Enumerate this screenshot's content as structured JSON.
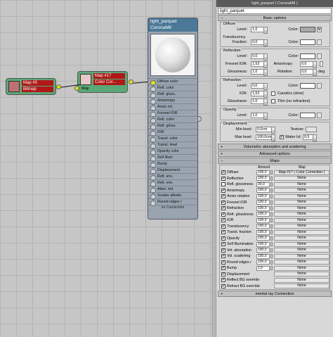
{
  "graph": {
    "bitmap_node": {
      "title": "Map #0",
      "subtitle": "Bitmap"
    },
    "cc_node": {
      "title": "Map #17",
      "subtitle": "Color Cor...",
      "port": "Map"
    },
    "material_node": {
      "title": "light_parquet",
      "subtitle": "CoronaMtl",
      "slots": [
        "Diffuse color",
        "Refl. color",
        "Refl. gloss.",
        "Anisotropy",
        "Aniso rot.",
        "Fresnel IOR",
        "Refr. color",
        "Refr. gloss.",
        "IOR",
        "Transl. color",
        "Transl. level",
        "Opacity color",
        "Self illum",
        "Bump",
        "Displacement",
        "Refl. env.",
        "Refr. env.",
        "Atten. tint",
        "Scatter albedo",
        "Round edges r"
      ],
      "footer": "mr Connection"
    },
    "node_color": "#5aa878",
    "header_color": "#b01818",
    "link_dot_color": "#dede10"
  },
  "panel": {
    "title": "light_parquet  ( CoronaMtl )",
    "name": "light_parquet",
    "basic_options": "Basic options",
    "diffuse": {
      "group": "Diffuse",
      "level_label": "Level:",
      "level": "1,0",
      "color_label": "Color:",
      "color": "#a8a8a8",
      "m": "M"
    },
    "translucency": {
      "group": "Translucency",
      "fraction_label": "Fraction:",
      "fraction": "0,0",
      "color_label": "Color:"
    },
    "reflection": {
      "group": "Reflection",
      "level_label": "Level:",
      "level": "0,0",
      "color_label": "Color:",
      "fresnel_label": "Fresnel IOR:",
      "fresnel": "1,52",
      "aniso_label": "Anisotropy:",
      "aniso": "0,0",
      "gloss_label": "Glossiness:",
      "gloss": "1,0",
      "rotation_label": "Rotation:",
      "rotation": "0,0",
      "rotation_unit": "deg"
    },
    "refraction": {
      "group": "Refraction",
      "level_label": "Level:",
      "level": "0,0",
      "color_label": "Color:",
      "ior_label": "IOR:",
      "ior": "1,52",
      "caustics": "Caustics (slow)",
      "gloss_label": "Glossiness:",
      "gloss": "1,0",
      "thin": "Thin (no refraction)"
    },
    "opacity": {
      "group": "Opacity",
      "level_label": "Level:",
      "level": "1,0",
      "color_label": "Color:"
    },
    "displacement": {
      "group": "Displacement",
      "min_label": "Min level:",
      "min": "0,0cm",
      "texture_label": "Texture:",
      "max_label": "Max level:",
      "max": "100,0cm",
      "water_label": "Water lvl:",
      "water": "0,5"
    },
    "rollouts": {
      "volumetric": "Volumetric absorption and scattering",
      "advanced": "Advanced options",
      "maps": "Maps",
      "mental_ray": "mental ray Connection"
    },
    "maps_table": {
      "amount_header": "Amount",
      "map_header": "Map",
      "rows": [
        {
          "checked": true,
          "name": "Diffuse",
          "amount": "100,0",
          "map": "Map #17  ( Color Correction )"
        },
        {
          "checked": true,
          "name": "Reflection",
          "amount": "100,0",
          "map": "None"
        },
        {
          "checked": false,
          "name": "Refl. glossiness",
          "amount": "30,0",
          "map": "None"
        },
        {
          "checked": true,
          "name": "Anisotropy",
          "amount": "100,0",
          "map": "None"
        },
        {
          "checked": true,
          "name": "Aniso rotation",
          "amount": "100,0",
          "map": "None"
        },
        {
          "checked": true,
          "name": "Fresnel IOR",
          "amount": "100,0",
          "map": "None"
        },
        {
          "checked": true,
          "name": "Refraction",
          "amount": "100,0",
          "map": "None"
        },
        {
          "checked": true,
          "name": "Refr. glossiness",
          "amount": "100,0",
          "map": "None"
        },
        {
          "checked": true,
          "name": "IOR",
          "amount": "100,0",
          "map": "None"
        },
        {
          "checked": true,
          "name": "Translucency",
          "amount": "100,0",
          "map": "None"
        },
        {
          "checked": true,
          "name": "Transl. fraction",
          "amount": "100,0",
          "map": "None"
        },
        {
          "checked": true,
          "name": "Opacity",
          "amount": "100,0",
          "map": "None"
        },
        {
          "checked": true,
          "name": "Self Illumination",
          "amount": "100,0",
          "map": "None"
        },
        {
          "checked": true,
          "name": "Vol. absorption",
          "amount": "100,0",
          "map": "None"
        },
        {
          "checked": true,
          "name": "Vol. scattering",
          "amount": "100,0",
          "map": "None"
        },
        {
          "checked": true,
          "name": "Round edges r",
          "amount": "100,0",
          "map": "None"
        },
        {
          "checked": true,
          "name": "Bump",
          "amount": "1,0",
          "map": "None"
        },
        {
          "checked": true,
          "name": "Displacement",
          "amount": "",
          "map": "None"
        },
        {
          "checked": true,
          "name": "Reflect BG override",
          "amount": "",
          "map": "None"
        },
        {
          "checked": true,
          "name": "Refract BG override",
          "amount": "",
          "map": "None"
        }
      ]
    }
  }
}
